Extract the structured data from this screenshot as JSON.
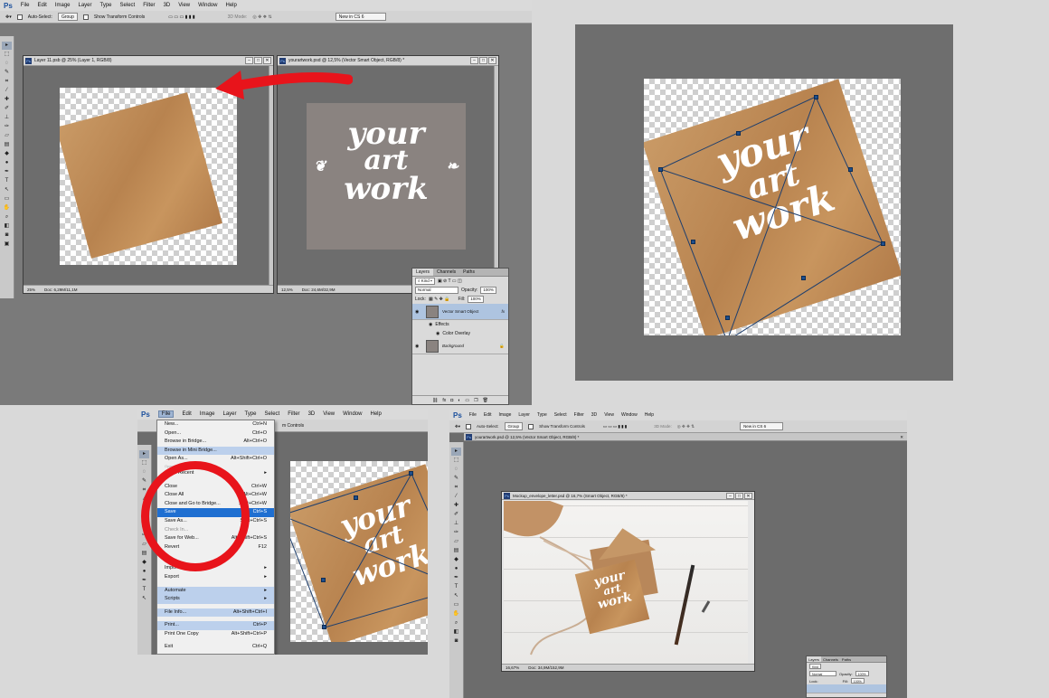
{
  "menu_items": [
    "File",
    "Edit",
    "Image",
    "Layer",
    "Type",
    "Select",
    "Filter",
    "3D",
    "View",
    "Window",
    "Help"
  ],
  "app_logo": "Ps",
  "options": {
    "auto_select": "Auto-Select:",
    "group": "Group",
    "show_transform": "Show Transform Controls",
    "mode_3d": "3D Mode:",
    "workspace": "New in CS 6"
  },
  "panel1": {
    "doc1": {
      "title": "Layer 11.psb @ 25% (Layer 1, RGB/8)",
      "zoom": "25%",
      "doc_size": "Doc: 6,29M/11,1M"
    },
    "doc2": {
      "title": "yourartwork.psd @ 12,5% (Vector Smart Object, RGB/8) *",
      "zoom": "12,5%",
      "doc_size": "Doc: 24,6M/32,9M"
    },
    "layers": {
      "tabs": [
        "Layers",
        "Channels",
        "Paths"
      ],
      "kind": "Kind",
      "blend": "Normal",
      "opacity_label": "Opacity:",
      "opacity": "100%",
      "lock_label": "Lock:",
      "fill_label": "Fill:",
      "fill": "100%",
      "items": [
        "Vector Smart Object",
        "Effects",
        "Color Overlay",
        "Background"
      ],
      "fx": "fx"
    }
  },
  "artwork": {
    "line1": "your",
    "line2": "art",
    "line3": "work",
    "flourish": "~ ❦ ~"
  },
  "panel3": {
    "menu_active": "File",
    "file_menu": [
      {
        "label": "New...",
        "shortcut": "Ctrl+N"
      },
      {
        "label": "Open...",
        "shortcut": "Ctrl+O"
      },
      {
        "label": "Browse in Bridge...",
        "shortcut": "Alt+Ctrl+O"
      },
      {
        "label": "Browse in Mini Bridge...",
        "shortcut": ""
      },
      {
        "label": "Open As...",
        "shortcut": "Alt+Shift+Ctrl+O"
      },
      {
        "label": "Open as Smart Object...",
        "shortcut": ""
      },
      {
        "label": "Open Recent",
        "shortcut": "▸"
      },
      {
        "label": "Close",
        "shortcut": "Ctrl+W"
      },
      {
        "label": "Close All",
        "shortcut": "Alt+Ctrl+W"
      },
      {
        "label": "Close and Go to Bridge...",
        "shortcut": "Shift+Ctrl+W"
      },
      {
        "label": "Save",
        "shortcut": "Ctrl+S"
      },
      {
        "label": "Save As...",
        "shortcut": "Shift+Ctrl+S"
      },
      {
        "label": "Check In...",
        "shortcut": ""
      },
      {
        "label": "Save for Web...",
        "shortcut": "Alt+Shift+Ctrl+S"
      },
      {
        "label": "Revert",
        "shortcut": "F12"
      },
      {
        "label": "Import",
        "shortcut": "▸"
      },
      {
        "label": "Export",
        "shortcut": "▸"
      },
      {
        "label": "Automate",
        "shortcut": "▸"
      },
      {
        "label": "Scripts",
        "shortcut": "▸"
      },
      {
        "label": "File Info...",
        "shortcut": "Alt+Shift+Ctrl+I"
      },
      {
        "label": "Print...",
        "shortcut": "Ctrl+P"
      },
      {
        "label": "Print One Copy",
        "shortcut": "Alt+Shift+Ctrl+P"
      },
      {
        "label": "Exit",
        "shortcut": "Ctrl+Q"
      }
    ],
    "behind_menu_text": "m Controls"
  },
  "panel4": {
    "tab_title": "yourartwork.psd @ 12,5% (Vector Smart Object, RGB/8) *",
    "doc": {
      "title": "Mockup_envelope_letter.psd @ 16,7% (Smart Object, RGB/8) *",
      "zoom": "16,67%",
      "doc_size": "Doc: 34,9M/152,9M"
    },
    "mini_layers": {
      "tabs": [
        "Layers",
        "Channels",
        "Paths"
      ],
      "kind": "Kind",
      "blend": "Normal",
      "opacity_label": "Opacity:",
      "opacity": "100%",
      "lock_label": "Lock:",
      "fill_label": "Fill:",
      "fill": "100%"
    }
  },
  "colors": {
    "arrow_red": "#e8141b",
    "circle_red": "#e8141b",
    "selection_blue": "#1f6fd1",
    "kraft": "#c08c58"
  }
}
